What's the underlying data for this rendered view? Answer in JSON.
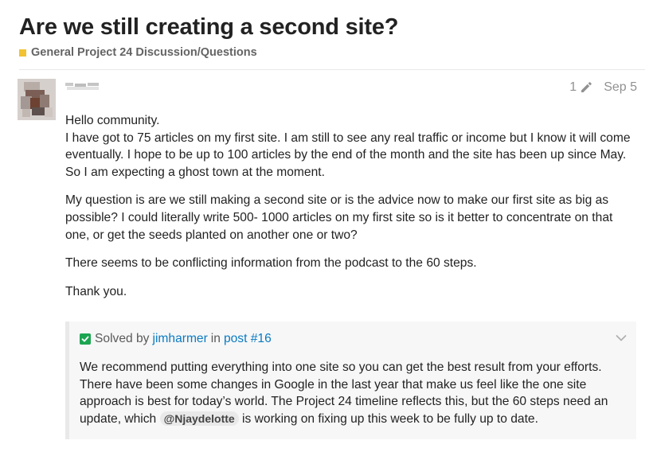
{
  "topic": {
    "title": "Are we still creating a second site?",
    "category_name": "General Project 24 Discussion/Questions",
    "category_color": "#F1C232"
  },
  "post": {
    "edit_count": "1",
    "date": "Sep 5",
    "paragraphs": [
      "Hello community.",
      "I have got to 75 articles on my first site. I am still to see any real traffic or income but I know it will come",
      "eventually. I hope to be up to 100 articles by the end of the month and the site has been up since May.",
      "So I am expecting a ghost town at the moment.",
      "My question is are we still making a second site or is the advice now to make our first site as big as",
      "possible? I could literally write 500- 1000 articles on my first site so is it better to concentrate on that",
      "one, or get the seeds planted on another one or two?",
      "There seems to be conflicting information from the podcast to the 60 steps.",
      "Thank you."
    ]
  },
  "solution": {
    "solved_by_label": "Solved by",
    "author": "jimharmer",
    "in_label": "in",
    "post_link": "post #16",
    "lines": [
      "We recommend putting everything into one site so you can get the best result from your efforts.",
      "There have been some changes in Google in the last year that make us feel like the one site",
      "approach is best for today’s world. The Project 24 timeline reflects this, but the 60 steps need an"
    ],
    "last_line_before": "update, which",
    "mention": "@Njaydelotte",
    "last_line_after": "is working on fixing up this week to be fully up to date."
  },
  "icons": {
    "edit": "pencil-icon",
    "solved": "checkbox-checked-icon",
    "expand": "chevron-down-icon"
  },
  "colors": {
    "link": "#0A7AC2",
    "solved_green": "#1CA551",
    "meta_gray": "#919191"
  }
}
